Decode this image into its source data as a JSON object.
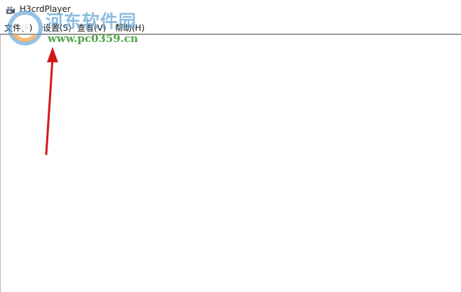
{
  "window": {
    "title": "H3crdPlayer",
    "icon": "app-icon"
  },
  "menubar": {
    "items": [
      {
        "label": "文件(F)"
      },
      {
        "label": "设置(S)"
      },
      {
        "label": "查看(V)"
      },
      {
        "label": "帮助(H)"
      }
    ]
  },
  "watermark": {
    "brand": "河东软件园",
    "url": "www.pc0359.cn"
  },
  "annotation": {
    "arrow_color": "#d0191b"
  }
}
